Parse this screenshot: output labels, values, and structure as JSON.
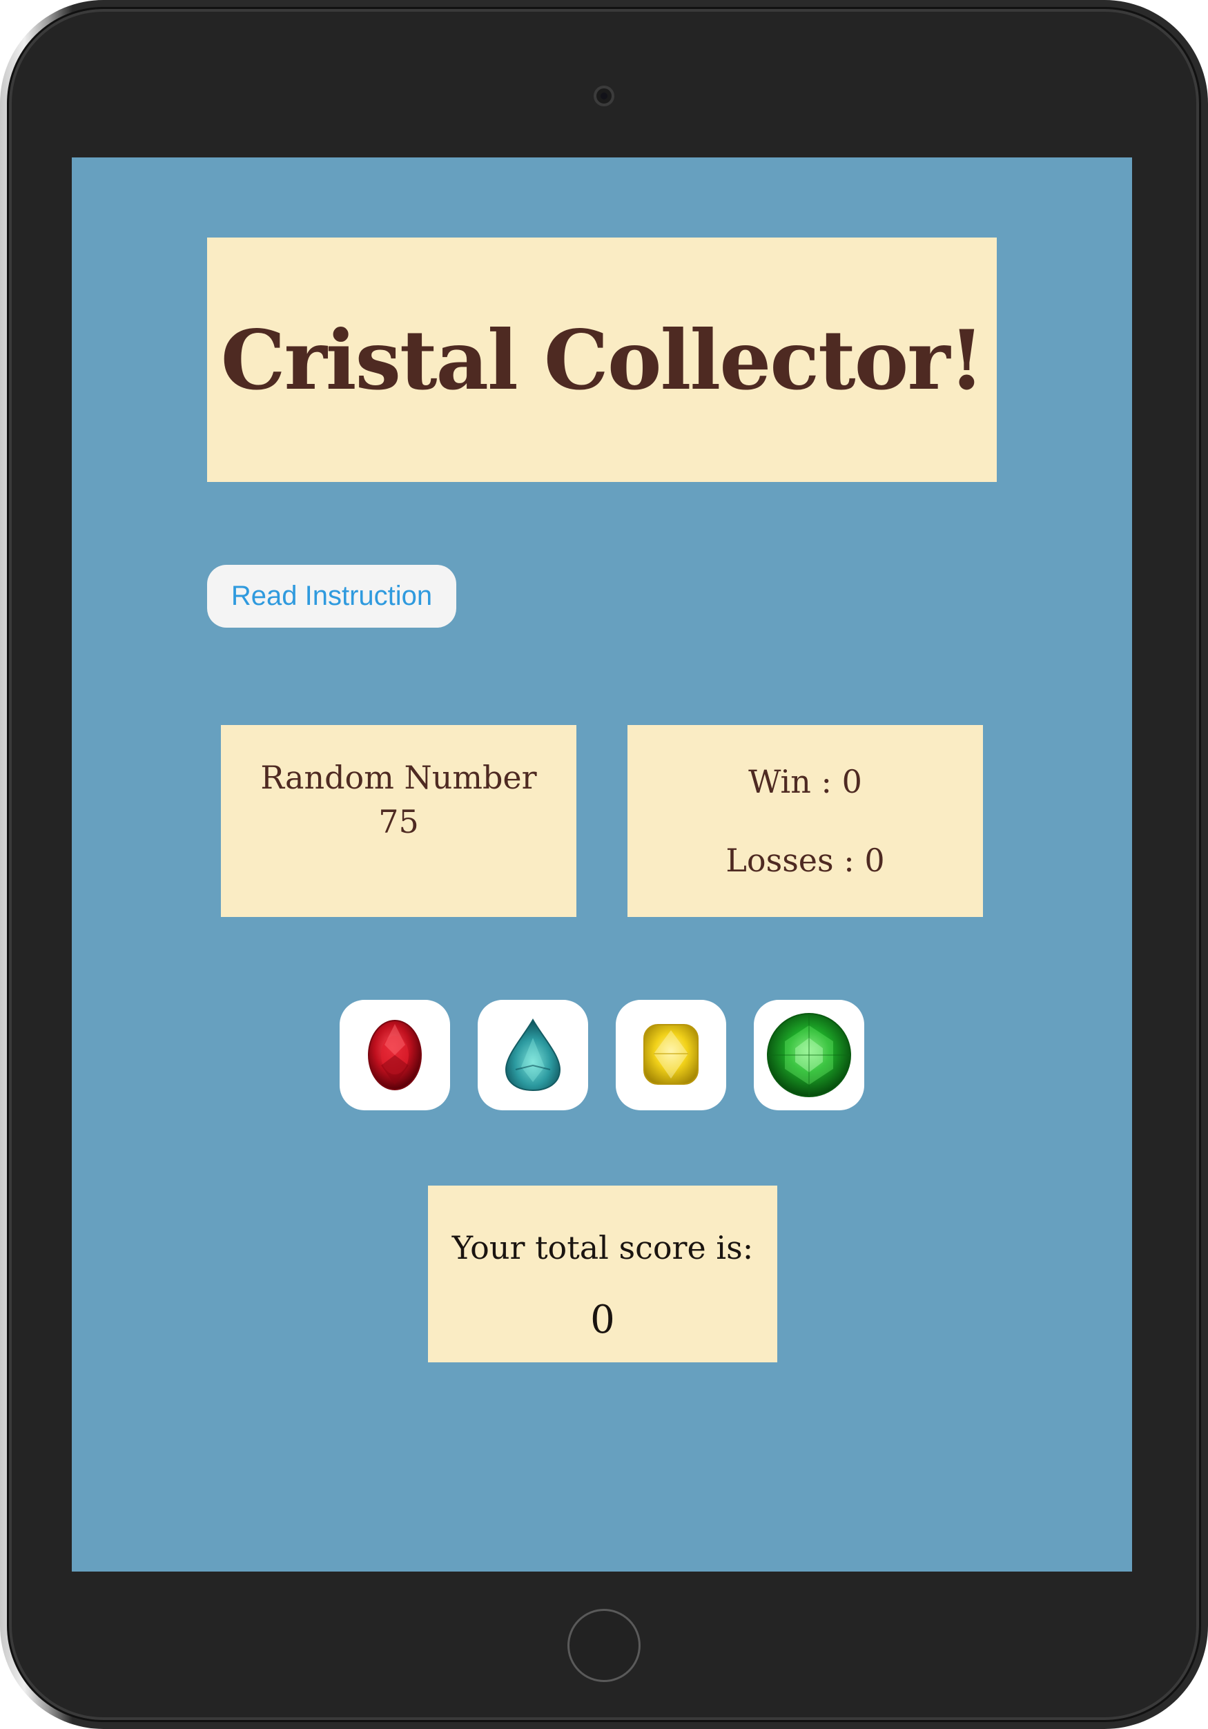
{
  "app": {
    "title": "Cristal Collector!"
  },
  "buttons": {
    "instructions_label": "Read Instruction"
  },
  "random_number": {
    "label": "Random Number",
    "value": "75"
  },
  "stats": {
    "win_text": "Win : 0",
    "losses_text": "Losses : 0"
  },
  "gems": [
    {
      "name": "red-ruby-icon",
      "color": "#c0101e"
    },
    {
      "name": "teal-pear-gem-icon",
      "color": "#2c9aa0"
    },
    {
      "name": "yellow-cushion-gem-icon",
      "color": "#f2d21a"
    },
    {
      "name": "green-round-gem-icon",
      "color": "#1fae2a"
    }
  ],
  "score": {
    "label": "Your total score is:",
    "value": "0"
  },
  "colors": {
    "screen_background": "#67a0bf",
    "panel_background": "#faecc4",
    "title_text": "#4e2a22",
    "button_text": "#2f9ade"
  }
}
